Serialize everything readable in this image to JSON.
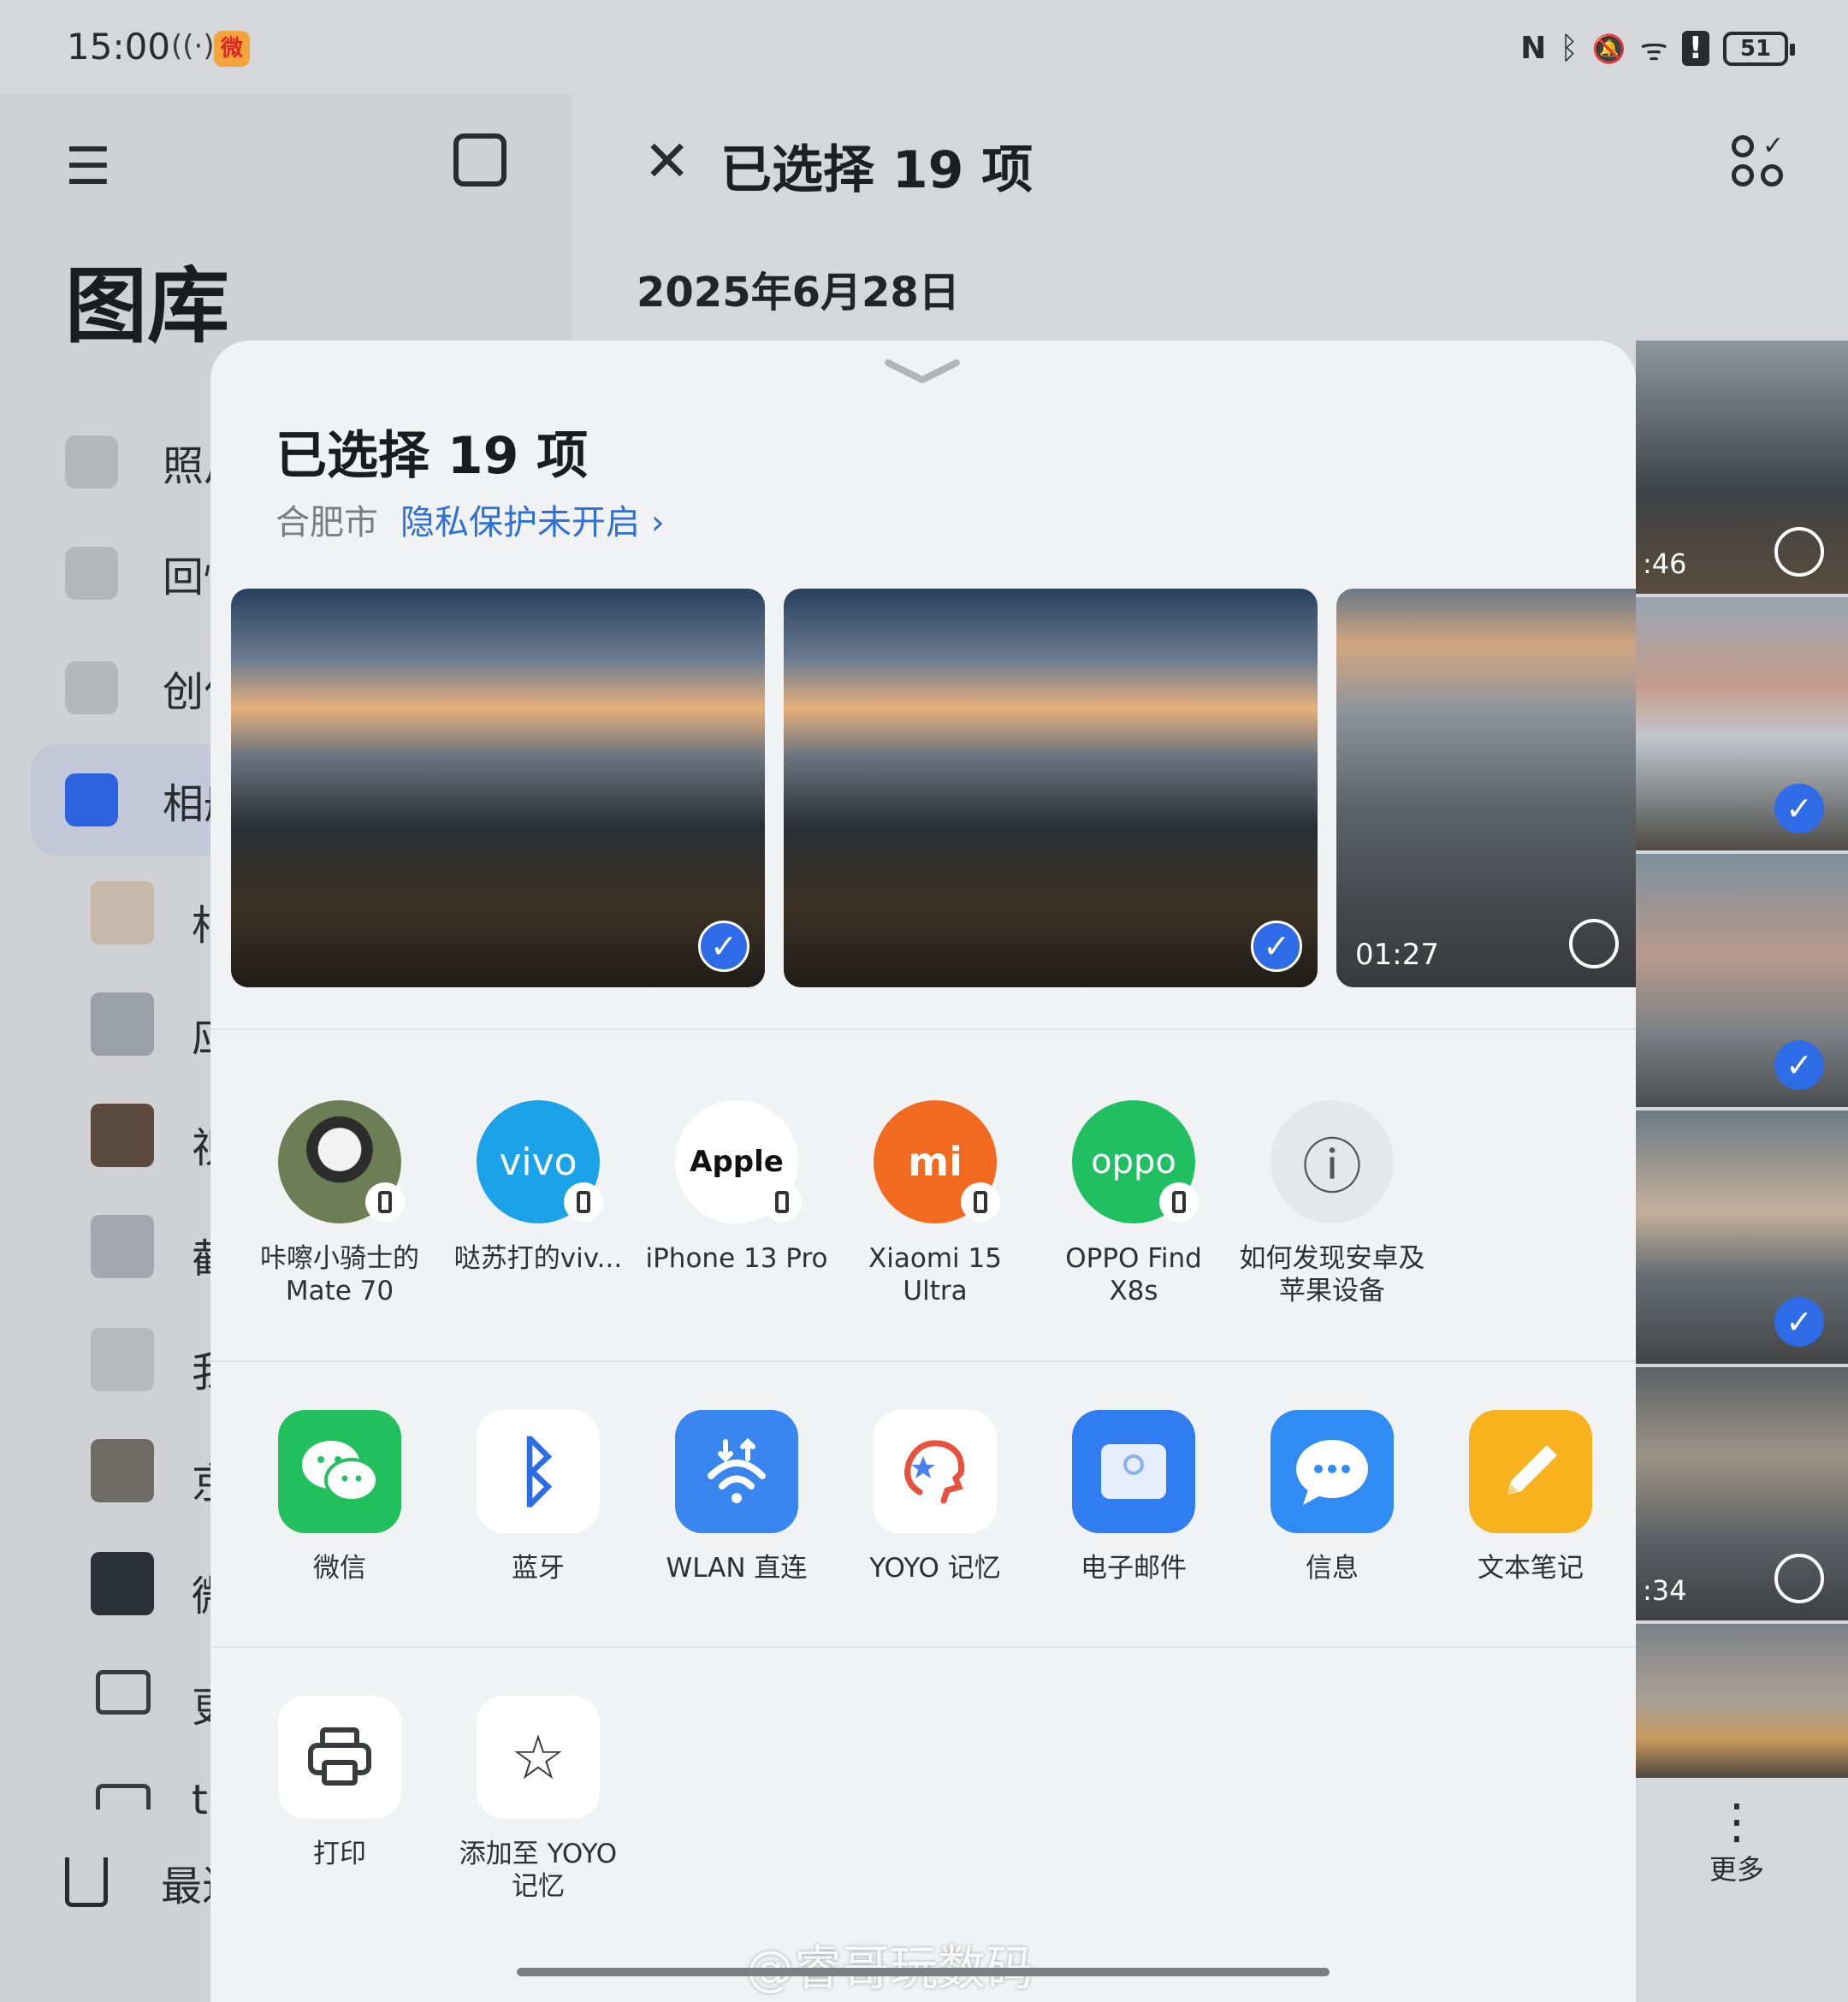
{
  "status_bar": {
    "time": "15:00",
    "hotspot_icon": "((·))",
    "weibo_icon": "微",
    "nfc": "N",
    "bluetooth": "ᛒ",
    "mute": "🔕",
    "wifi": "ᯤ",
    "alert": "!",
    "battery": "51"
  },
  "sidebar": {
    "title": "图库",
    "items": [
      {
        "label": "照片"
      },
      {
        "label": "回忆"
      },
      {
        "label": "创作"
      },
      {
        "label": "相册"
      }
    ],
    "albums": [
      {
        "label": "相"
      },
      {
        "label": "应"
      },
      {
        "label": "视"
      },
      {
        "label": "截"
      },
      {
        "label": "我"
      },
      {
        "label": "京"
      },
      {
        "label": "微"
      },
      {
        "label": "更"
      },
      {
        "label": "t"
      }
    ],
    "trash_label": "最近"
  },
  "gallery": {
    "header_title": "已选择 19 项",
    "date": "2025年6月28日",
    "thumbs": [
      {
        "duration": ":46",
        "selected": false
      },
      {
        "duration": "",
        "selected": true
      },
      {
        "duration": "",
        "selected": true
      },
      {
        "duration": "",
        "selected": true
      },
      {
        "duration": ":34",
        "selected": false
      },
      {
        "duration": "",
        "selected": false
      }
    ],
    "more_label": "更多"
  },
  "sheet": {
    "title": "已选择 19 项",
    "location": "合肥市",
    "privacy": "隐私保护未开启 ›",
    "previews": [
      {
        "selected": true,
        "duration": ""
      },
      {
        "selected": true,
        "duration": ""
      },
      {
        "selected": false,
        "duration": "01:27"
      }
    ],
    "devices": [
      {
        "label": "咔嚓小骑士的\nMate 70",
        "icon": "avatar-panda",
        "color": "#5c6b4a"
      },
      {
        "label": "哒苏打的viv...",
        "icon": "vivo",
        "color": "#1aa3e8",
        "text": "vivo"
      },
      {
        "label": "iPhone 13 Pro",
        "icon": "apple",
        "color": "#ffffff",
        "text": "Apple"
      },
      {
        "label": "Xiaomi 15\nUltra",
        "icon": "xiaomi",
        "color": "#f26a1f",
        "text": "mi"
      },
      {
        "label": "OPPO Find\nX8s",
        "icon": "oppo",
        "color": "#1fbf62",
        "text": "oppo"
      },
      {
        "label": "如何发现安卓及\n苹果设备",
        "icon": "info",
        "color": "#e6e7ea",
        "text": "ⓘ"
      }
    ],
    "apps": [
      {
        "label": "微信",
        "icon": "wechat",
        "color": "#22c15e"
      },
      {
        "label": "蓝牙",
        "icon": "bluetooth",
        "color": "#ffffff"
      },
      {
        "label": "WLAN 直连",
        "icon": "wlan-direct",
        "color": "#3a86f0"
      },
      {
        "label": "YOYO 记忆",
        "icon": "yoyo",
        "color": "#ffffff"
      },
      {
        "label": "电子邮件",
        "icon": "email",
        "color": "#2f7df0"
      },
      {
        "label": "信息",
        "icon": "message",
        "color": "#2f8cf3"
      },
      {
        "label": "文本笔记",
        "icon": "notes",
        "color": "#f8b21e"
      }
    ],
    "actions": [
      {
        "label": "打印",
        "icon": "printer"
      },
      {
        "label": "添加至 YOYO\n记忆",
        "icon": "star"
      }
    ]
  },
  "watermark": "@睿哥玩数码"
}
